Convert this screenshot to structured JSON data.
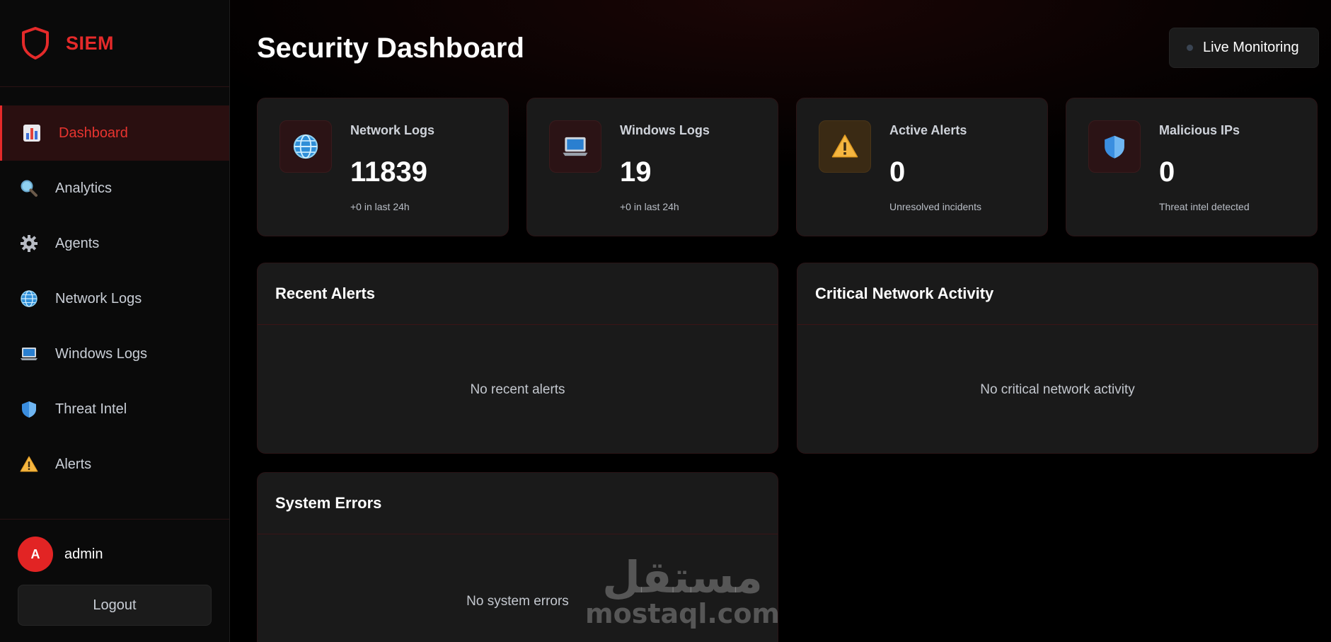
{
  "brand": {
    "name": "SIEM",
    "accent": "#e52a2a"
  },
  "sidebar": {
    "items": [
      {
        "label": "Dashboard",
        "icon": "bar-chart-icon",
        "active": true
      },
      {
        "label": "Analytics",
        "icon": "magnifier-icon",
        "active": false
      },
      {
        "label": "Agents",
        "icon": "gear-icon",
        "active": false
      },
      {
        "label": "Network Logs",
        "icon": "globe-icon",
        "active": false
      },
      {
        "label": "Windows Logs",
        "icon": "laptop-icon",
        "active": false
      },
      {
        "label": "Threat Intel",
        "icon": "shield-icon",
        "active": false
      },
      {
        "label": "Alerts",
        "icon": "warning-icon",
        "active": false
      }
    ],
    "user": {
      "avatar_letter": "A",
      "name": "admin"
    },
    "logout_label": "Logout"
  },
  "header": {
    "title": "Security Dashboard",
    "live_label": "Live Monitoring"
  },
  "stats": [
    {
      "title": "Network Logs",
      "value": "11839",
      "sub": "+0 in last 24h",
      "icon": "globe-icon"
    },
    {
      "title": "Windows Logs",
      "value": "19",
      "sub": "+0 in last 24h",
      "icon": "laptop-icon"
    },
    {
      "title": "Active Alerts",
      "value": "0",
      "sub": "Unresolved incidents",
      "icon": "warning-icon"
    },
    {
      "title": "Malicious IPs",
      "value": "0",
      "sub": "Threat intel detected",
      "icon": "shield-icon"
    }
  ],
  "panels": {
    "recent_alerts": {
      "title": "Recent Alerts",
      "empty": "No recent alerts"
    },
    "critical_network": {
      "title": "Critical Network Activity",
      "empty": "No critical network activity"
    },
    "system_errors": {
      "title": "System Errors",
      "empty": "No system errors"
    }
  },
  "watermark": {
    "arabic": "مستقل",
    "latin": "mostaql.com"
  }
}
